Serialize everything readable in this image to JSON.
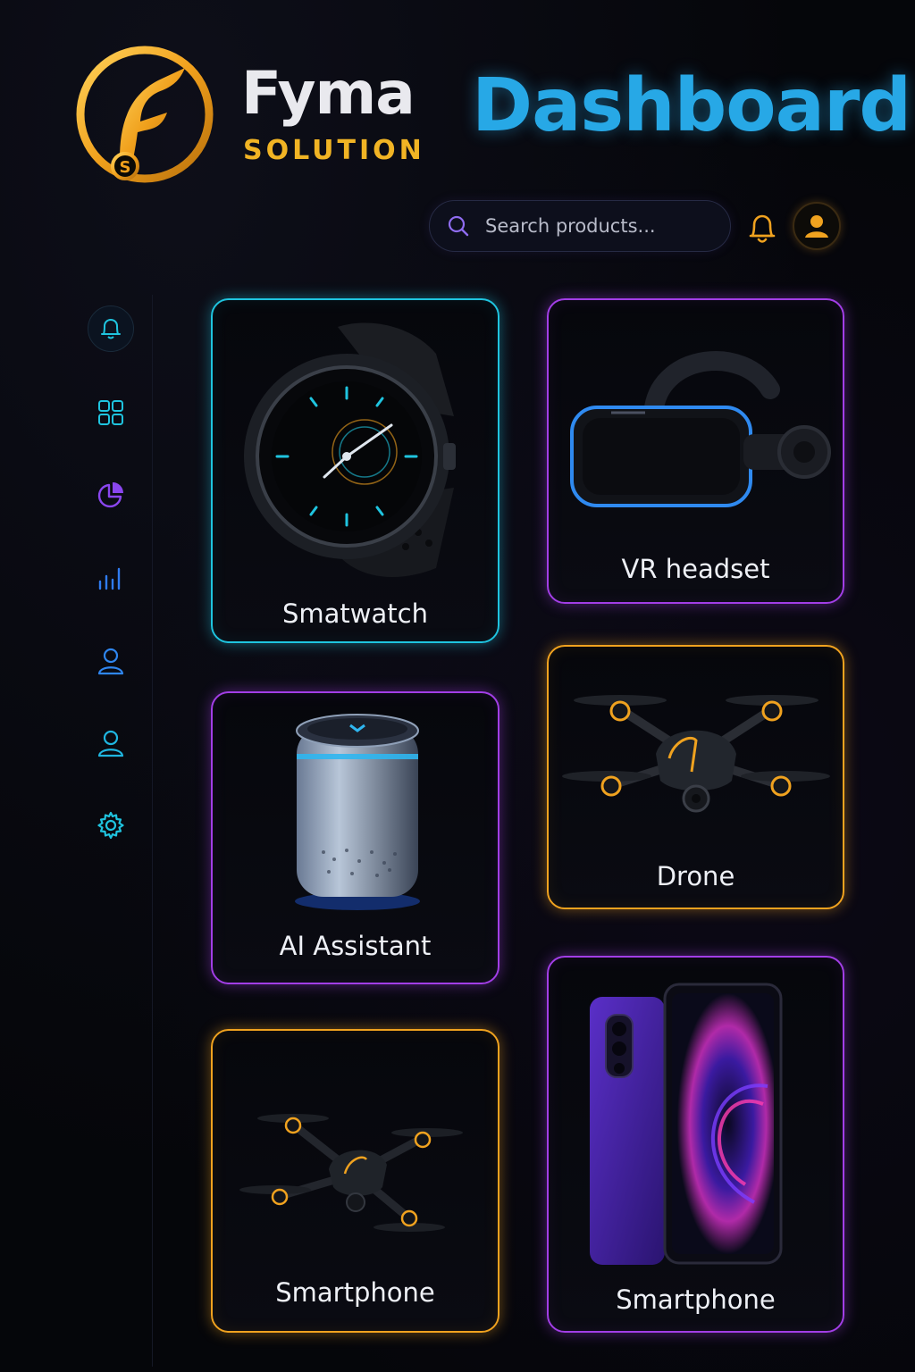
{
  "brand": {
    "name": "Fyma",
    "subtitle": "SOLUTION",
    "logo_letter": "S"
  },
  "header": {
    "title": "Dashboard"
  },
  "search": {
    "placeholder": "Search products..."
  },
  "colors": {
    "accent_cyan": "#1fc4df",
    "accent_purple": "#a23ee6",
    "accent_orange": "#f0a21f",
    "title_blue": "#27a8e6",
    "brand_gold": "#f1b424"
  },
  "sidebar": {
    "items": [
      {
        "icon": "bell-icon",
        "active": true
      },
      {
        "icon": "grid-icon",
        "active": false
      },
      {
        "icon": "pie-chart-icon",
        "active": false
      },
      {
        "icon": "bar-chart-icon",
        "active": false
      },
      {
        "icon": "user-icon",
        "active": false
      },
      {
        "icon": "user-icon",
        "active": false
      },
      {
        "icon": "gear-icon",
        "active": false
      }
    ]
  },
  "products": [
    {
      "label": "Smatwatch",
      "accent": "cyan"
    },
    {
      "label": "VR headset",
      "accent": "purple"
    },
    {
      "label": "AI Assistant",
      "accent": "purple"
    },
    {
      "label": "Drone",
      "accent": "orange"
    },
    {
      "label": "Smartphone",
      "accent": "orange"
    },
    {
      "label": "Smartphone",
      "accent": "purple"
    }
  ]
}
